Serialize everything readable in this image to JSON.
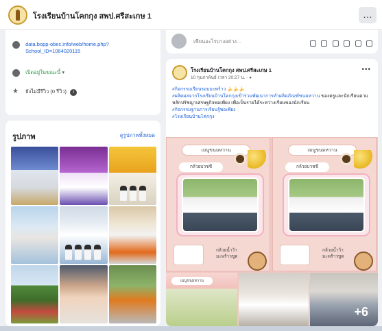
{
  "header": {
    "title": "โรงเรียนบ้านโคกกุง สพป.ศรีสะเกษ 1",
    "more_label": "…"
  },
  "about": {
    "link_line1": "data.bopp-obec.info/web/home.php?",
    "link_line2": "School_ID=1064020115",
    "status": "เปิดอยู่ในขณะนี้",
    "status_arrow": "▾",
    "reviews": "ยังไม่มีรีวิว (0 รีวิว)",
    "reviews_badge": "i"
  },
  "photos": {
    "heading": "รูปภาพ",
    "see_all": "ดูรูปภาพทั้งหมด"
  },
  "composer": {
    "placeholder": "เขียนอะไรบางอย่าง..."
  },
  "post": {
    "author": "โรงเรียนบ้านโคกกุง สพป.ศรีสะเกษ 1",
    "meta": "10 กุมภาพันธ์ เวลา 20:27 น. · ●",
    "more": "•••",
    "hashtag1": "#กิจกรรมเรียนรอบมะพร้าว 🍌🍌🍌",
    "line1_tag": "#ผลิตผลจากโรงเรียนบ้านโคกกุงเข้าร่วมพัฒนาการทำผลิตภัณฑ์ขนมหวาน",
    "line1_text": " ของครูและนักเรียนตามหลักปรัชญาเศรษฐกิจพอเพียง เพื่อเป็นรายได้ระหว่างเรียนของนักเรียน",
    "hashtag2": "#กิจกรรมฐานการเรียนรู้พอเพียง",
    "hashtag3": "#โรงเรียนบ้านโคกกุง"
  },
  "media": {
    "poster_title": "เมนูขนมหวาน",
    "poster_sub": "กล้วยบวชชี",
    "poster_note": "กล้วยน้ำว้า\nมะพร้าวขูด",
    "mini_title": "เมนูขนมหวาน",
    "extra_count": "+6"
  }
}
